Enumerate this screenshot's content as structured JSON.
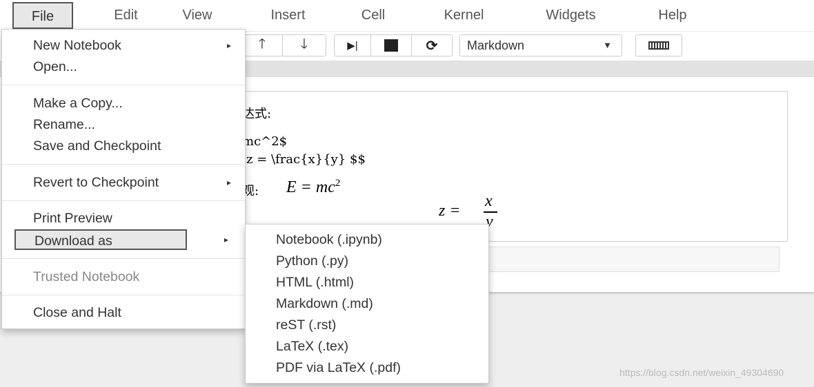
{
  "menubar": {
    "items": [
      "File",
      "Edit",
      "View",
      "Insert",
      "Cell",
      "Kernel",
      "Widgets",
      "Help"
    ]
  },
  "toolbar": {
    "cell_type": "Markdown"
  },
  "cell": {
    "line1": "达式:",
    "line2": "mc^2$",
    "line3": "z = \\frac{x}{y} $$",
    "line4_prefix": "观:",
    "formula1": "E = mc",
    "formula1_sup": "2",
    "formula2_lhs": "z =",
    "formula2_num": "x",
    "formula2_den": "y"
  },
  "file_menu": {
    "items": [
      {
        "label": "New Notebook",
        "submenu": true
      },
      {
        "label": "Open..."
      },
      {
        "label": "Make a Copy..."
      },
      {
        "label": "Rename..."
      },
      {
        "label": "Save and Checkpoint"
      },
      {
        "label": "Revert to Checkpoint",
        "submenu": true
      },
      {
        "label": "Print Preview"
      },
      {
        "label": "Download as",
        "submenu": true,
        "highlighted": true
      },
      {
        "label": "Trusted Notebook",
        "disabled": true
      },
      {
        "label": "Close and Halt"
      }
    ],
    "submenu_arrow": "▸"
  },
  "download_menu": {
    "items": [
      "Notebook (.ipynb)",
      "Python (.py)",
      "HTML (.html)",
      "Markdown (.md)",
      "reST (.rst)",
      "LaTeX (.tex)",
      "PDF via LaTeX (.pdf)"
    ]
  },
  "watermark": "https://blog.csdn.net/weixin_49304690"
}
